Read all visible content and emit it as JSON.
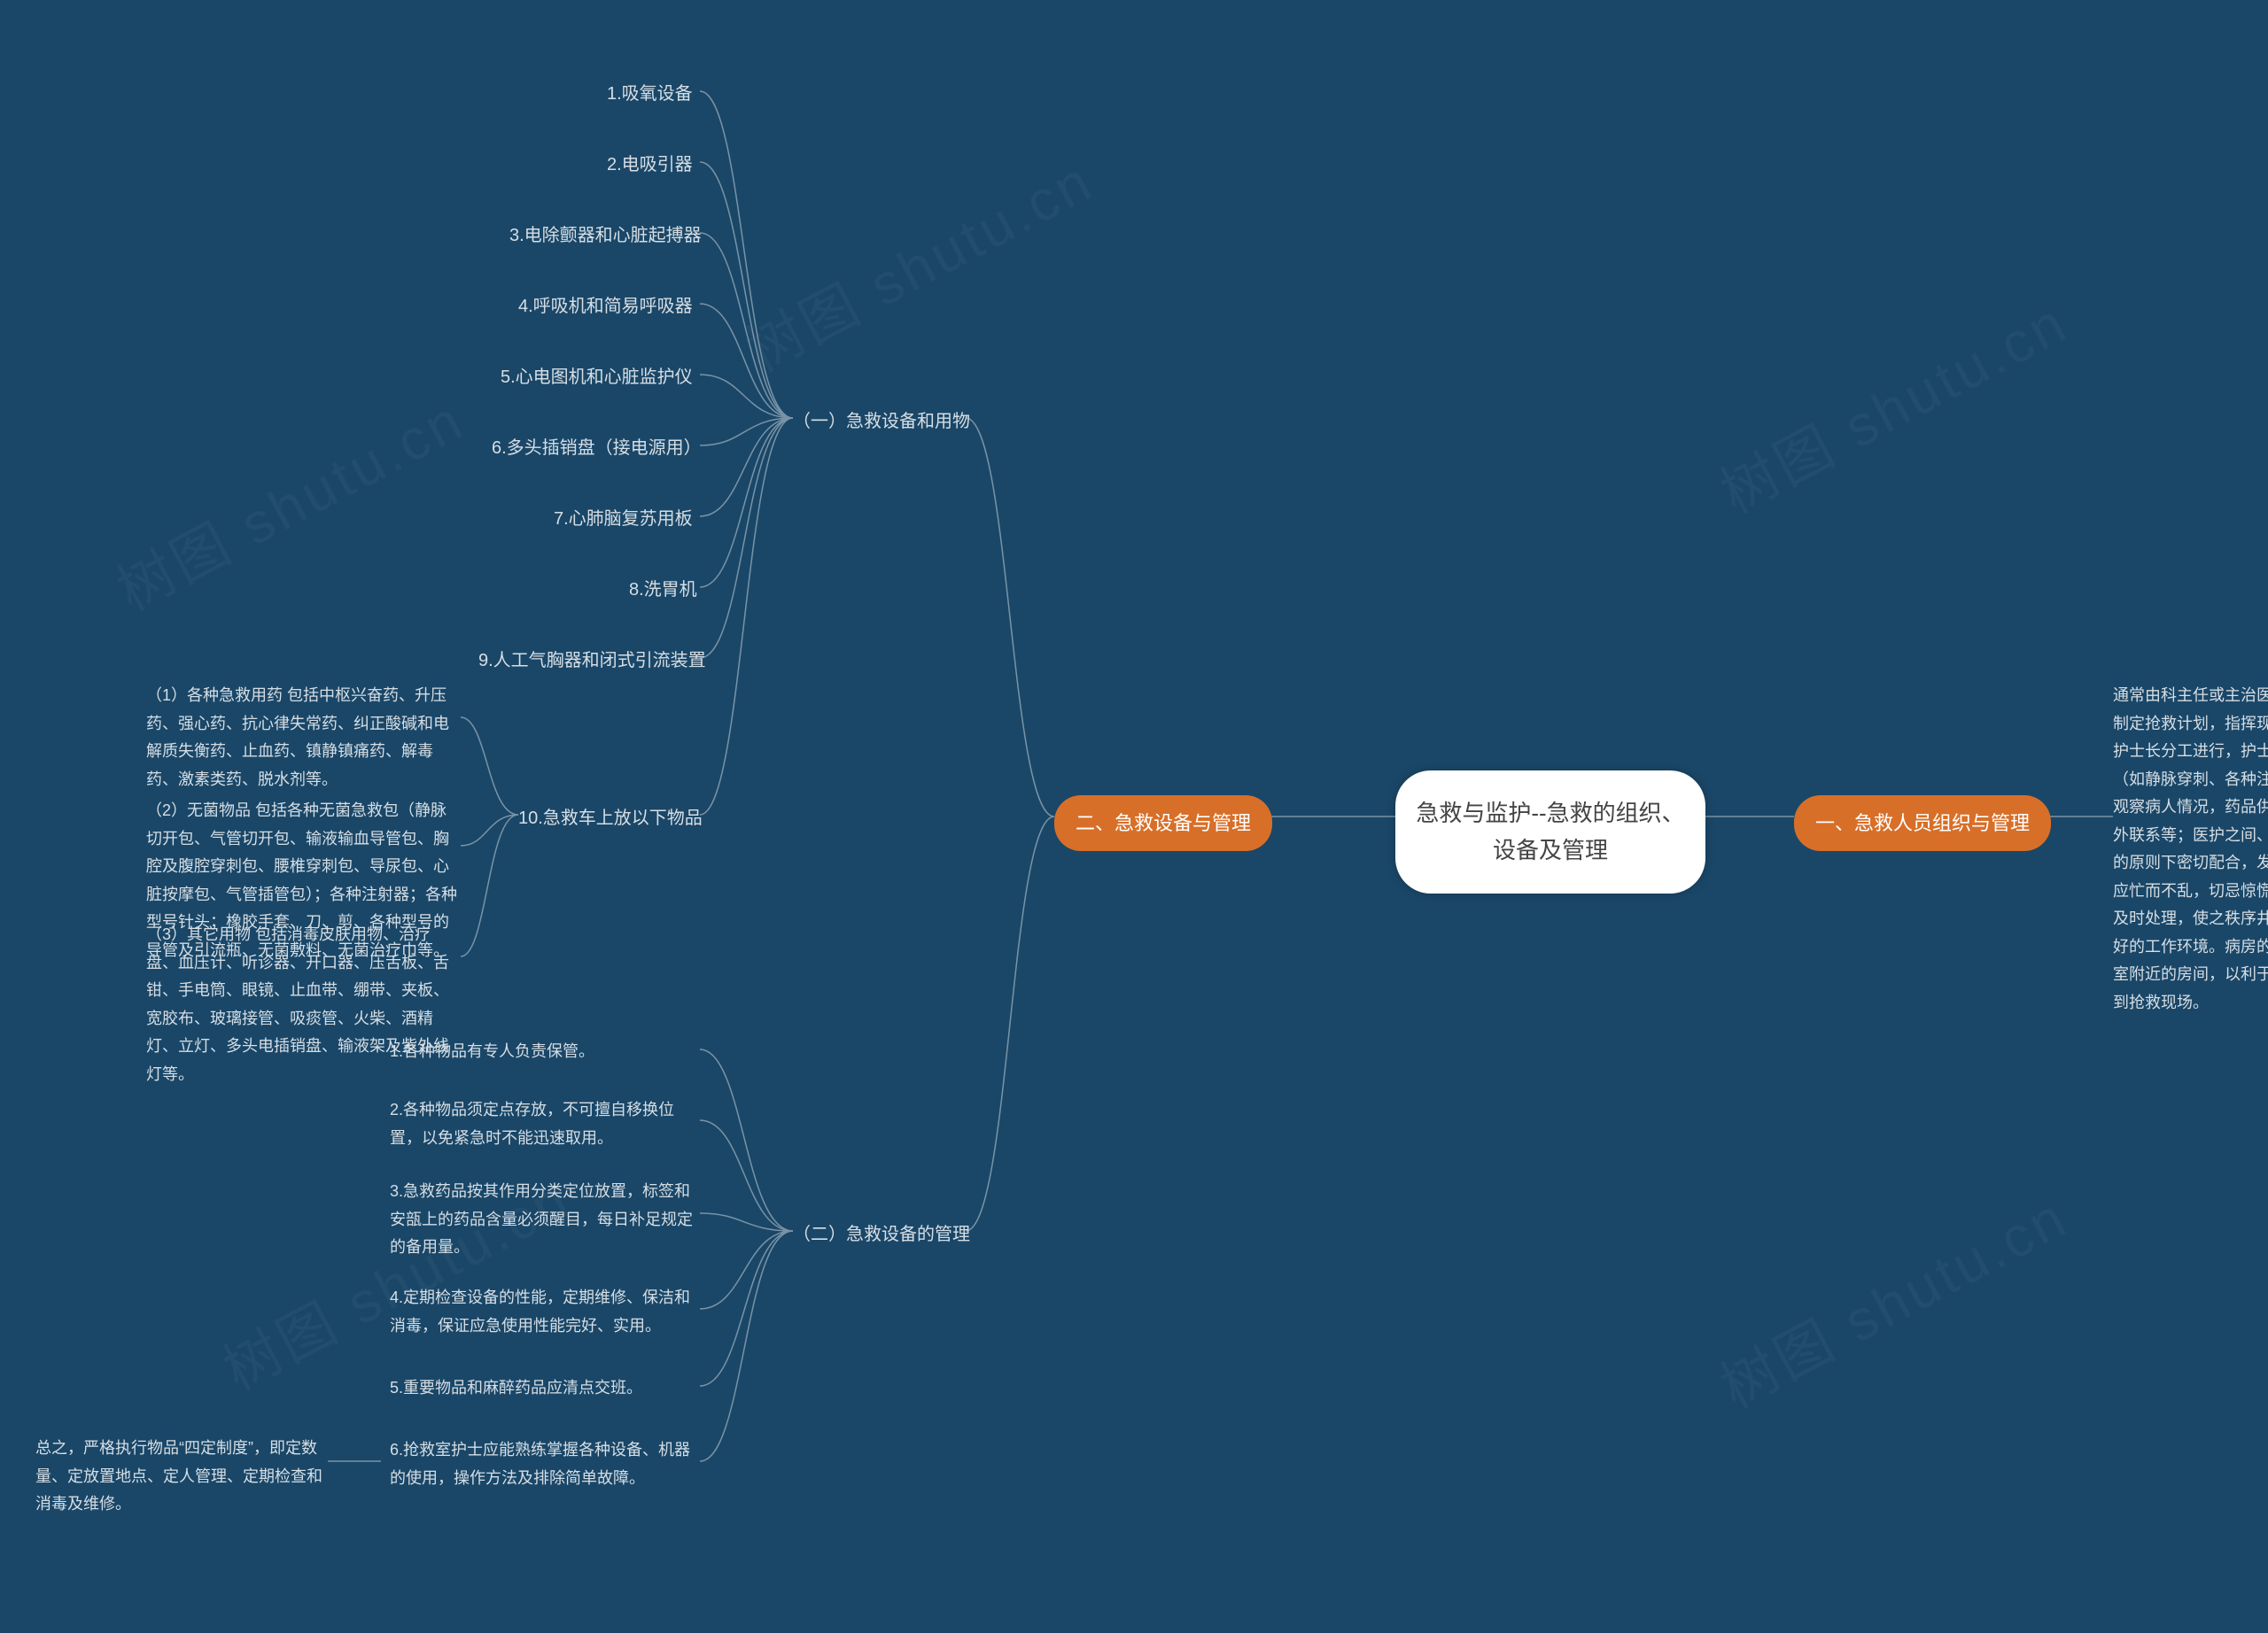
{
  "watermark_text": "树图 shutu.cn",
  "root": "急救与监护--急救的组织、设备及管理",
  "branch_right": {
    "title": "一、急救人员组织与管理",
    "detail": "通常由科主任或主治医师负责组织抢救小组，制定抢救计划，指挥现场抢救行动。护理则由护士长分工进行，护士的工作有直接处理病人（如静脉穿刺、各种注射、吸氧、插管等），观察病人情况，药品供应，书写抢救记录及对外联系等；医护之间、护士与护士之间在分工的原则下密切配合，发挥最高效能。抢救现场应忙而不乱，切忌惊慌失措，大声呼叫，用物及时处理，使之秩序井然，为抢救造成一个良好的工作环境。病房的抢救室应设在医护办公室附近的房间，以利于医护人员能迅速地集中到抢救现场。"
  },
  "branch_left": {
    "title": "二、急救设备与管理",
    "sub_a": {
      "title": "（一）急救设备和用物",
      "items": [
        "1.吸氧设备",
        "2.电吸引器",
        "3.电除颤器和心脏起搏器",
        "4.呼吸机和简易呼吸器",
        "5.心电图机和心脏监护仪",
        "6.多头插销盘（接电源用）",
        "7.心肺脑复苏用板",
        "8.洗胃机",
        "9.人工气胸器和闭式引流装置",
        "10.急救车上放以下物品"
      ],
      "item10_sub": [
        "（1）各种急救用药 包括中枢兴奋药、升压药、强心药、抗心律失常药、纠正酸碱和电解质失衡药、止血药、镇静镇痛药、解毒药、激素类药、脱水剂等。",
        "（2）无菌物品 包括各种无菌急救包（静脉切开包、气管切开包、输液输血导管包、胸腔及腹腔穿刺包、腰椎穿刺包、导尿包、心脏按摩包、气管插管包）；各种注射器；各种型号针头；橡胶手套、刀、剪、各种型号的导管及引流瓶、无菌敷料、无菌治疗巾等。",
        "（3）其它用物 包括消毒皮肤用物、治疗盘、血压计、听诊器、开口器、压舌板、舌钳、手电筒、眼镜、止血带、绷带、夹板、宽胶布、玻璃接管、吸痰管、火柴、酒精灯、立灯、多头电插销盘、输液架及紫外线灯等。"
      ]
    },
    "sub_b": {
      "title": "（二）急救设备的管理",
      "items": [
        "1.各种物品有专人负责保管。",
        "2.各种物品须定点存放，不可擅自移换位置，以免紧急时不能迅速取用。",
        "3.急救药品按其作用分类定位放置，标签和安瓿上的药品含量必须醒目，每日补足规定的备用量。",
        "4.定期检查设备的性能，定期维修、保洁和消毒，保证应急使用性能完好、实用。",
        "5.重要物品和麻醉药品应清点交班。",
        "6.抢救室护士应能熟练掌握各种设备、机器的使用，操作方法及排除简单故障。"
      ],
      "item6_note": "总之，严格执行物品“四定制度”，即定数量、定放置地点、定人管理、定期检查和消毒及维修。"
    }
  }
}
